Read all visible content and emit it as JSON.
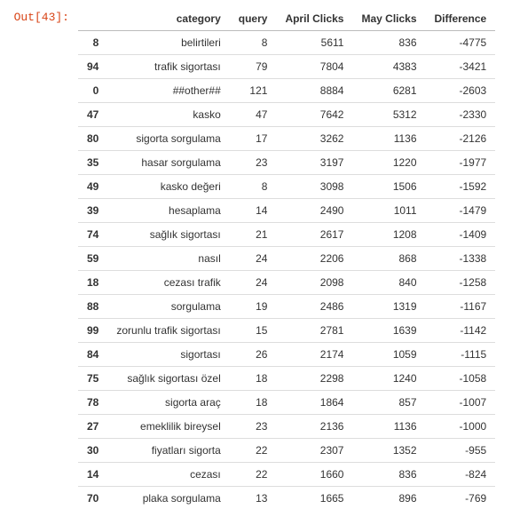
{
  "prompt": "Out[43]:",
  "chart_data": {
    "type": "table",
    "columns": [
      "category",
      "query",
      "April Clicks",
      "May Clicks",
      "Difference"
    ],
    "index": [
      "8",
      "94",
      "0",
      "47",
      "80",
      "35",
      "49",
      "39",
      "74",
      "59",
      "18",
      "88",
      "99",
      "84",
      "75",
      "78",
      "27",
      "30",
      "14",
      "70"
    ],
    "rows": [
      {
        "category": "belirtileri",
        "query": 8,
        "april": 5611,
        "may": 836,
        "diff": -4775
      },
      {
        "category": "trafik sigortası",
        "query": 79,
        "april": 7804,
        "may": 4383,
        "diff": -3421
      },
      {
        "category": "##other##",
        "query": 121,
        "april": 8884,
        "may": 6281,
        "diff": -2603
      },
      {
        "category": "kasko",
        "query": 47,
        "april": 7642,
        "may": 5312,
        "diff": -2330
      },
      {
        "category": "sigorta sorgulama",
        "query": 17,
        "april": 3262,
        "may": 1136,
        "diff": -2126
      },
      {
        "category": "hasar sorgulama",
        "query": 23,
        "april": 3197,
        "may": 1220,
        "diff": -1977
      },
      {
        "category": "kasko değeri",
        "query": 8,
        "april": 3098,
        "may": 1506,
        "diff": -1592
      },
      {
        "category": "hesaplama",
        "query": 14,
        "april": 2490,
        "may": 1011,
        "diff": -1479
      },
      {
        "category": "sağlık sigortası",
        "query": 21,
        "april": 2617,
        "may": 1208,
        "diff": -1409
      },
      {
        "category": "nasıl",
        "query": 24,
        "april": 2206,
        "may": 868,
        "diff": -1338
      },
      {
        "category": "cezası trafik",
        "query": 24,
        "april": 2098,
        "may": 840,
        "diff": -1258
      },
      {
        "category": "sorgulama",
        "query": 19,
        "april": 2486,
        "may": 1319,
        "diff": -1167
      },
      {
        "category": "zorunlu trafik sigortası",
        "query": 15,
        "april": 2781,
        "may": 1639,
        "diff": -1142
      },
      {
        "category": "sigortası",
        "query": 26,
        "april": 2174,
        "may": 1059,
        "diff": -1115
      },
      {
        "category": "sağlık sigortası özel",
        "query": 18,
        "april": 2298,
        "may": 1240,
        "diff": -1058
      },
      {
        "category": "sigorta araç",
        "query": 18,
        "april": 1864,
        "may": 857,
        "diff": -1007
      },
      {
        "category": "emeklilik bireysel",
        "query": 23,
        "april": 2136,
        "may": 1136,
        "diff": -1000
      },
      {
        "category": "fiyatları sigorta",
        "query": 22,
        "april": 2307,
        "may": 1352,
        "diff": -955
      },
      {
        "category": "cezası",
        "query": 22,
        "april": 1660,
        "may": 836,
        "diff": -824
      },
      {
        "category": "plaka sorgulama",
        "query": 13,
        "april": 1665,
        "may": 896,
        "diff": -769
      }
    ]
  }
}
